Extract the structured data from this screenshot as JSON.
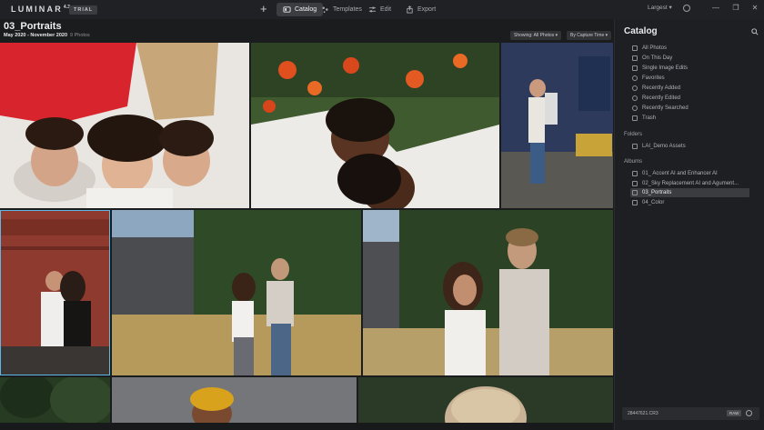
{
  "app": {
    "logo": "LUMINAR",
    "version": "4.3",
    "trial_badge": "TRIAL"
  },
  "nav": {
    "add": "+",
    "tabs": [
      {
        "label": "Catalog",
        "active": true
      },
      {
        "label": "Templates",
        "active": false
      },
      {
        "label": "Edit",
        "active": false
      },
      {
        "label": "Export",
        "active": false
      }
    ],
    "size_select": "Largest",
    "window": {
      "minimize": "—",
      "restore": "❐",
      "close": "✕"
    }
  },
  "gallery": {
    "title": "03_Portraits",
    "date_range": "May 2020 - November 2020",
    "count": "9 Photos",
    "filter_chip": "Showing: All Photos",
    "sort_chip": "By Capture Time"
  },
  "panel": {
    "title": "Catalog",
    "shortcuts": [
      "All Photos",
      "On This Day",
      "Single Image Edits",
      "Favorites",
      "Recently Added",
      "Recently Edited",
      "Recently Searched",
      "Trash"
    ],
    "folders_header": "Folders",
    "folders": [
      "LAI_Demo Assets"
    ],
    "albums_header": "Albums",
    "albums": [
      {
        "label": "01_ Accent AI and Enhancer AI",
        "active": false
      },
      {
        "label": "02_Sky Replacement AI and Agument...",
        "active": false
      },
      {
        "label": "03_Portraits",
        "active": true
      },
      {
        "label": "04_Color",
        "active": false
      }
    ],
    "file": {
      "name": "28447621.CR3",
      "badge": "RAW"
    }
  },
  "colors": {
    "accent": "#5fb7e6",
    "background": "#1b1c1e",
    "panel": "#1e1f22"
  }
}
